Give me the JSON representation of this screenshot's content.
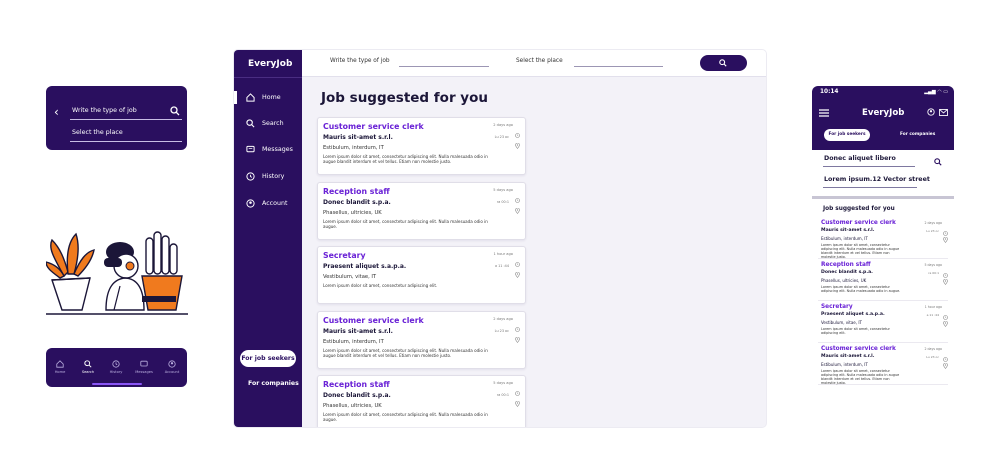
{
  "colors": {
    "primary": "#2a0f5f",
    "accent": "#6a22d6",
    "indicator": "#8a55f5",
    "illustration_orange": "#f07a1e"
  },
  "mobile_search": {
    "job_placeholder": "Write the type of job",
    "place_placeholder": "Select the place"
  },
  "mobile_tabs": [
    {
      "label": "Home",
      "icon": "home-icon"
    },
    {
      "label": "Search",
      "icon": "search-icon"
    },
    {
      "label": "History",
      "icon": "history-icon"
    },
    {
      "label": "Messages",
      "icon": "messages-icon"
    },
    {
      "label": "Account",
      "icon": "account-icon"
    }
  ],
  "mobile_active_tab": "Search",
  "desktop": {
    "logo": "EveryJob",
    "job_type_label": "Write the type of job",
    "place_label": "Select the place",
    "nav": [
      {
        "label": "Home",
        "icon": "home-icon"
      },
      {
        "label": "Search",
        "icon": "search-icon"
      },
      {
        "label": "Messages",
        "icon": "messages-icon"
      },
      {
        "label": "History",
        "icon": "history-icon"
      },
      {
        "label": "Account",
        "icon": "account-icon"
      }
    ],
    "active_nav": "Home",
    "for_job_seekers": "For job seekers",
    "for_companies": "For companies",
    "page_title": "Job suggested for you",
    "jobs": [
      {
        "title": "Customer service clerk",
        "company": "Mauris sit-amet s.r.l.",
        "location": "Estibulum, interdum, IT",
        "posted": "2 days ago",
        "time": "Lu 23 oc",
        "description": "Lorem ipsum dolor sit amet, consectetur adipiscing elit. Nulla malesuada odio in augue blandit interdum et vel tellus. Etiam non molestie justo."
      },
      {
        "title": "Reception staff",
        "company": "Donec blandit s.p.a.",
        "location": "Phasellus, ultricies, UK",
        "posted": "5 days ago",
        "time": "ra 00:1",
        "description": "Lorem ipsum dolor sit amet, consectetur adipiscing elit. Nulla malesuada odio in augue."
      },
      {
        "title": "Secretary",
        "company": "Praesent aliquet s.a.p.a.",
        "location": "Vestibulum, vitae, IT",
        "posted": "1 hour ago",
        "time": "a 11 :44",
        "description": "Lorem ipsum dolor sit amet, consectetur adipiscing elit."
      },
      {
        "title": "Customer service clerk",
        "company": "Mauris sit-amet s.r.l.",
        "location": "Estibulum, interdum, IT",
        "posted": "2 days ago",
        "time": "Lu 23 oc",
        "description": "Lorem ipsum dolor sit amet, consectetur adipiscing elit. Nulla malesuada odio in augue blandit interdum et vel tellus. Etiam non molestie justo."
      },
      {
        "title": "Reception staff",
        "company": "Donec blandit s.p.a.",
        "location": "Phasellus, ultricies, UK",
        "posted": "5 days ago",
        "time": "ra 00:1",
        "description": "Lorem ipsum dolor sit amet, consectetur adipiscing elit. Nulla malesuada odio in augue."
      }
    ]
  },
  "phone": {
    "time": "10:14",
    "logo": "EveryJob",
    "seg_seekers": "For job seekers",
    "seg_companies": "For companies",
    "job_field": "Donec aliquet libero",
    "place_field": "Lorem ipsum.12 Vector street",
    "section_title": "Job suggested for you",
    "jobs": [
      {
        "title": "Customer service clerk",
        "company": "Mauris sit-amet s.r.l.",
        "location": "Estibulum, interdum, IT",
        "posted": "2 days ago",
        "time": "Lu 23 oc",
        "description": "Lorem ipsum dolor sit amet, consectetur adipiscing elit. Nulla malesuada odio in augue blandit interdum et vel tellus. Etiam non molestie justo."
      },
      {
        "title": "Reception staff",
        "company": "Donec blandit s.p.a.",
        "location": "Phasellus, ultricies, UK",
        "posted": "5 days ago",
        "time": "ra 00:1",
        "description": "Lorem ipsum dolor sit amet, consectetur adipiscing elit. Nulla malesuada odio in augue."
      },
      {
        "title": "Secretary",
        "company": "Praesent aliquet s.a.p.a.",
        "location": "Vestibulum, vitae, IT",
        "posted": "1 hour ago",
        "time": "a 11 :44",
        "description": "Lorem ipsum dolor sit amet, consectetur adipiscing elit."
      },
      {
        "title": "Customer service clerk",
        "company": "Mauris sit-amet s.r.l.",
        "location": "Estibulum, interdum, IT",
        "posted": "2 days ago",
        "time": "Lu 23 oc",
        "description": "Lorem ipsum dolor sit amet, consectetur adipiscing elit. Nulla malesuada odio in augue blandit interdum et vel tellus. Etiam non molestie justo."
      }
    ]
  }
}
